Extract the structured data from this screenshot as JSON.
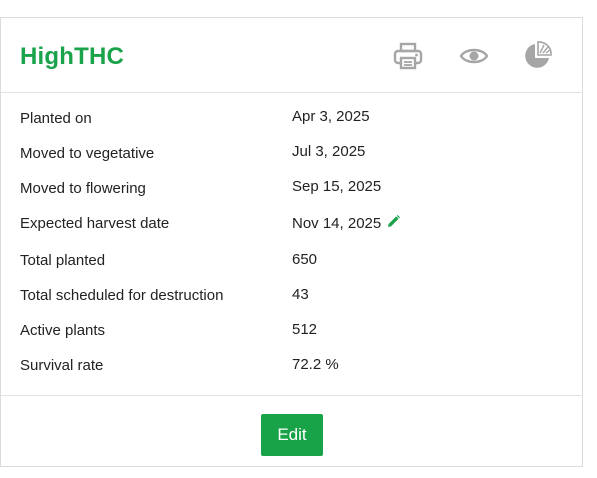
{
  "card": {
    "title": "HighTHC",
    "icons": {
      "print": "printer-icon",
      "view": "eye-icon",
      "stats": "pie-chart-icon"
    },
    "rows": [
      {
        "label": "Planted on",
        "value": "Apr 3, 2025"
      },
      {
        "label": "Moved to vegetative",
        "value": "Jul 3, 2025"
      },
      {
        "label": "Moved to flowering",
        "value": "Sep 15, 2025"
      },
      {
        "label": "Expected harvest date",
        "value": "Nov 14, 2025",
        "editable": true
      },
      {
        "label": "Total planted",
        "value": "650"
      },
      {
        "label": "Total scheduled for destruction",
        "value": "43"
      },
      {
        "label": "Active plants",
        "value": "512"
      },
      {
        "label": "Survival rate",
        "value": "72.2 %"
      }
    ],
    "edit_label": "Edit"
  },
  "colors": {
    "accent": "#1aa34a",
    "icon_gray": "#a6a6a6",
    "border": "#dcdcdc"
  }
}
